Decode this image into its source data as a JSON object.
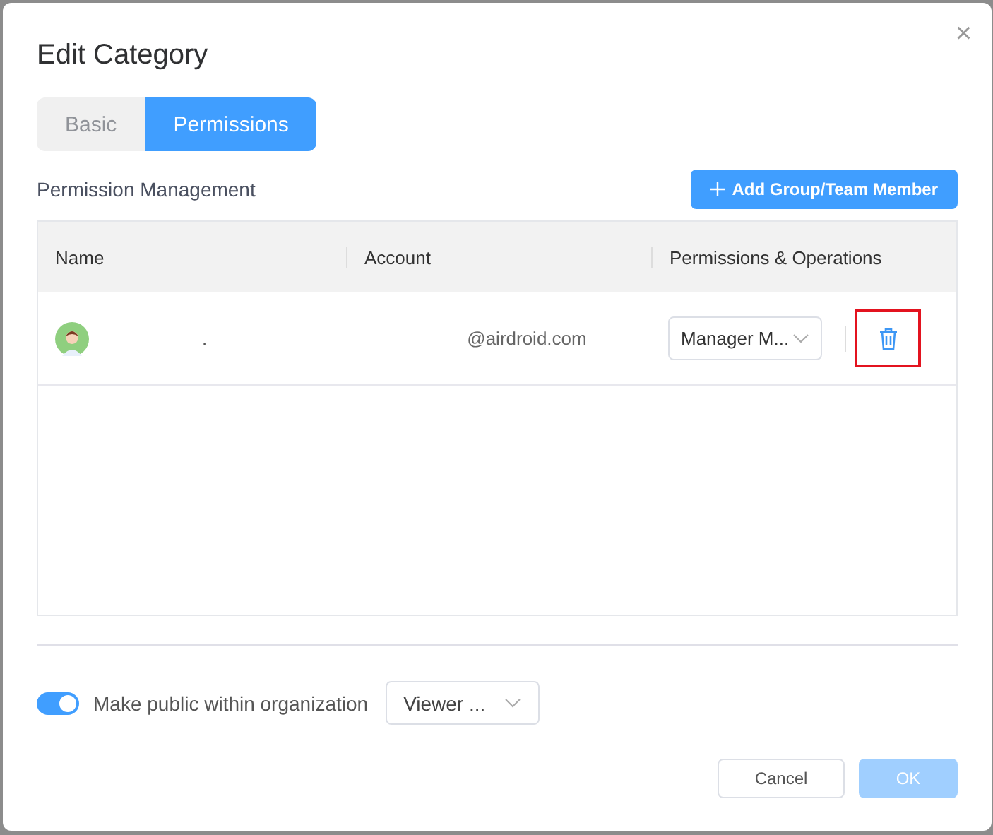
{
  "dialog": {
    "title": "Edit Category",
    "close": "×"
  },
  "tabs": [
    {
      "label": "Basic",
      "selected": false
    },
    {
      "label": "Permissions",
      "selected": true
    }
  ],
  "section": {
    "title": "Permission Management",
    "add_button": "Add Group/Team Member"
  },
  "table": {
    "columns": [
      "Name",
      "Account",
      "Permissions & Operations"
    ],
    "rows": [
      {
        "name": ".",
        "account": "@airdroid.com",
        "permission": "Manager M...",
        "highlighted": true
      }
    ]
  },
  "public": {
    "on": true,
    "label": "Make public within organization",
    "role": "Viewer ..."
  },
  "buttons": {
    "cancel": "Cancel",
    "ok": "OK",
    "ok_disabled": true
  }
}
